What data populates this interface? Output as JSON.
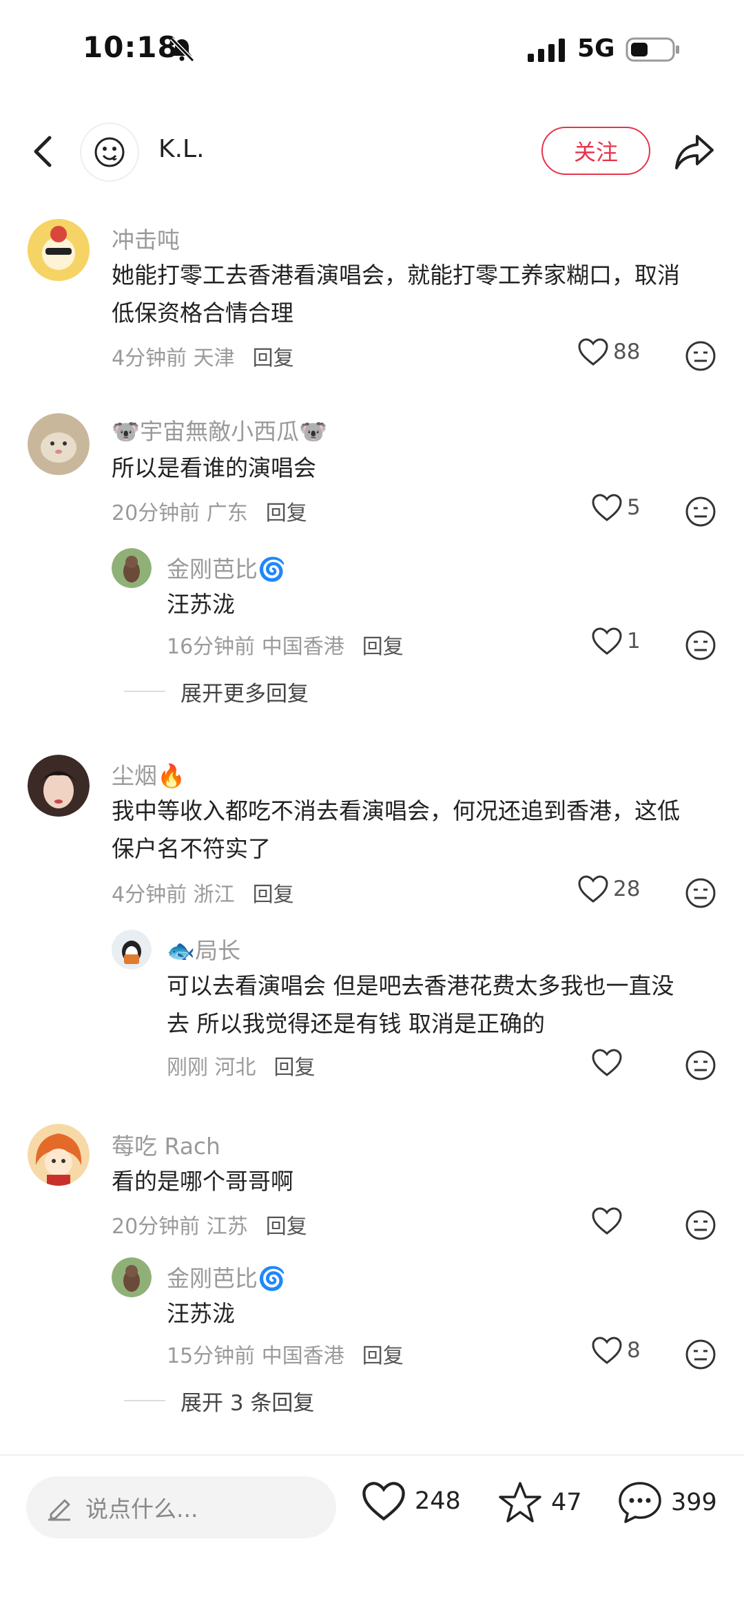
{
  "status": {
    "time": "10:18",
    "network": "5G"
  },
  "header": {
    "author": "K.L.",
    "follow_label": "关注"
  },
  "comments": [
    {
      "user": "冲击吨",
      "text_lines": [
        "她能打零工去香港看演唱会，就能打零工养家糊口，取消",
        "低保资格合情合理"
      ],
      "meta": "4分钟前 天津",
      "reply": "回复",
      "likes": "88"
    },
    {
      "user": "🐨宇宙無敵小西瓜🐨",
      "text_lines": [
        "所以是看谁的演唱会"
      ],
      "meta": "20分钟前 广东",
      "reply": "回复",
      "likes": "5",
      "replies": [
        {
          "user": "金刚芭比🌀",
          "text_lines": [
            "汪苏泷"
          ],
          "meta": "16分钟前 中国香港",
          "reply": "回复",
          "likes": "1"
        }
      ],
      "expand": "展开更多回复"
    },
    {
      "user": "尘烟🔥",
      "text_lines": [
        "我中等收入都吃不消去看演唱会，何况还追到香港，这低",
        "保户名不符实了"
      ],
      "meta": "4分钟前 浙江",
      "reply": "回复",
      "likes": "28",
      "replies": [
        {
          "user": "🐟局长",
          "text_lines": [
            "可以去看演唱会 但是吧去香港花费太多我也一直没",
            "去 所以我觉得还是有钱 取消是正确的"
          ],
          "meta": "刚刚 河北",
          "reply": "回复",
          "likes": ""
        }
      ]
    },
    {
      "user": "莓吃 Rach",
      "text_lines": [
        "看的是哪个哥哥啊"
      ],
      "meta": "20分钟前 江苏",
      "reply": "回复",
      "likes": "",
      "replies": [
        {
          "user": "金刚芭比🌀",
          "text_lines": [
            "汪苏泷"
          ],
          "meta": "15分钟前 中国香港",
          "reply": "回复",
          "likes": "8"
        }
      ],
      "expand": "展开 3 条回复"
    }
  ],
  "bottom": {
    "input_placeholder": "说点什么...",
    "likes": "248",
    "stars": "47",
    "comments": "399"
  },
  "colors": {
    "accent": "#e6334a",
    "muted": "#9a9a9a"
  }
}
